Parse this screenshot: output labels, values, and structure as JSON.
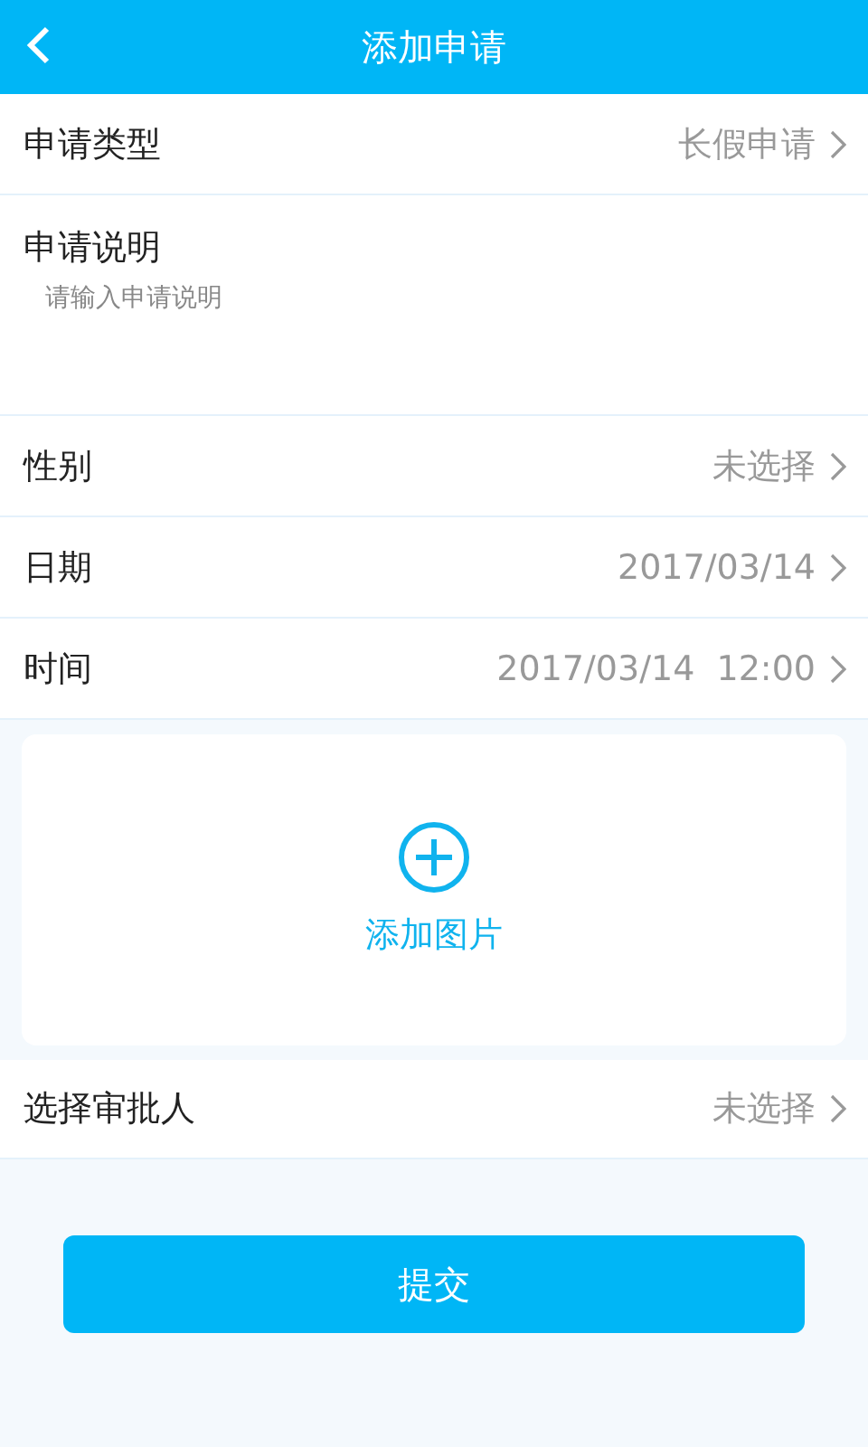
{
  "header": {
    "title": "添加申请"
  },
  "rows": [
    {
      "kind": "select",
      "label": "申请类型",
      "value": "长假申请"
    },
    {
      "kind": "textarea",
      "label": "申请说明",
      "placeholder": "请输入申请说明"
    },
    {
      "kind": "select",
      "label": "性别",
      "value": "未选择"
    },
    {
      "kind": "select",
      "label": "日期",
      "value": "2017/03/14"
    },
    {
      "kind": "select",
      "label": "时间",
      "value": "2017/03/14  12:00"
    }
  ],
  "image_upload": {
    "label": "添加图片"
  },
  "approver": {
    "kind": "select",
    "label": "选择审批人",
    "value": "未选择"
  },
  "submit": {
    "label": "提交"
  }
}
